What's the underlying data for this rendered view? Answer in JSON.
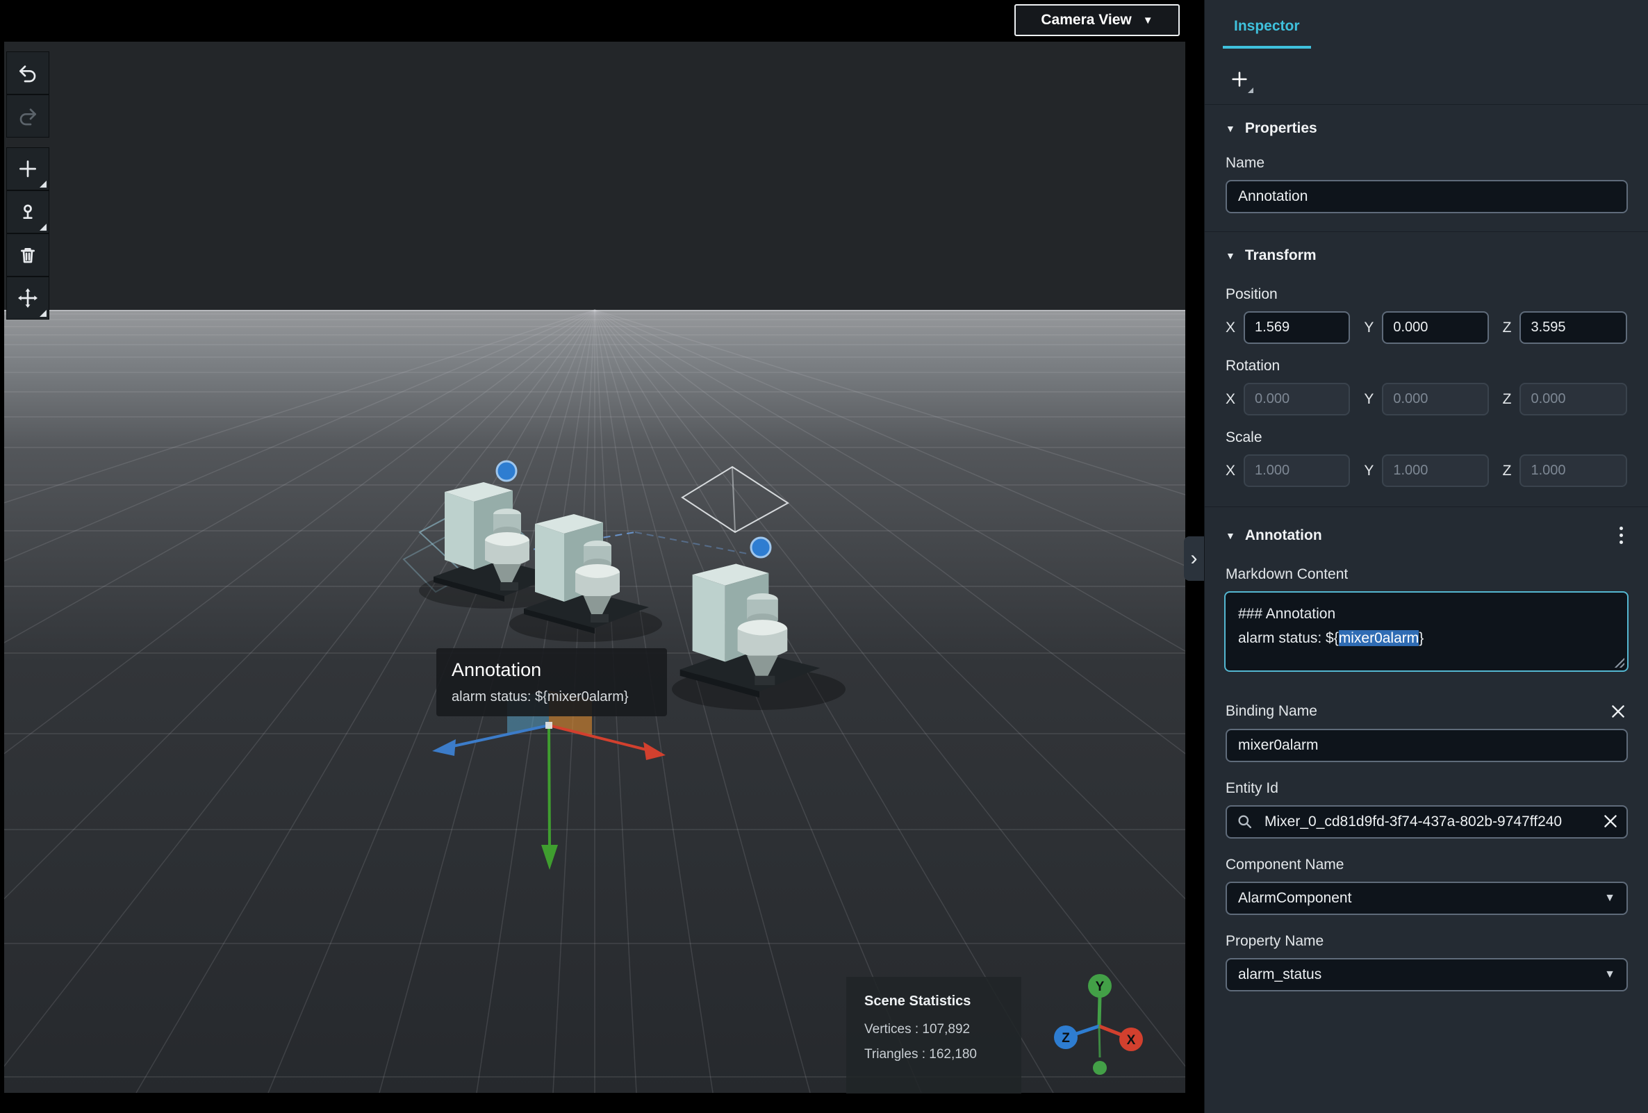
{
  "viewport": {
    "camera_view_button": "Camera View",
    "tooltip": {
      "title": "Annotation",
      "body": "alarm status: ${mixer0alarm}"
    },
    "scene_statistics": {
      "title": "Scene Statistics",
      "vertices": "Vertices : 107,892",
      "triangles": "Triangles : 162,180"
    },
    "axis_gizmo": {
      "x": "X",
      "y": "Y",
      "z": "Z"
    }
  },
  "toolbar": {
    "buttons": [
      "undo",
      "redo",
      "add-object",
      "add-anchor",
      "delete",
      "move"
    ]
  },
  "inspector": {
    "tab": "Inspector",
    "properties": {
      "title": "Properties",
      "name_label": "Name",
      "name_value": "Annotation"
    },
    "transform": {
      "title": "Transform",
      "x_label": "X",
      "y_label": "Y",
      "z_label": "Z",
      "position": {
        "label": "Position",
        "x": "1.569",
        "y": "0.000",
        "z": "3.595"
      },
      "rotation": {
        "label": "Rotation",
        "x": "0.000",
        "y": "0.000",
        "z": "0.000"
      },
      "scale": {
        "label": "Scale",
        "x": "1.000",
        "y": "1.000",
        "z": "1.000"
      }
    },
    "annotation": {
      "title": "Annotation",
      "markdown_label": "Markdown Content",
      "markdown_line1": "### Annotation",
      "markdown_prefix": "alarm status: ${",
      "markdown_selected": "mixer0alarm",
      "markdown_suffix": "}",
      "binding_name_label": "Binding Name",
      "binding_name_value": "mixer0alarm",
      "entity_id_label": "Entity Id",
      "entity_id_value": "Mixer_0_cd81d9fd-3f74-437a-802b-9747ff240",
      "component_name_label": "Component Name",
      "component_name_value": "AlarmComponent",
      "property_name_label": "Property Name",
      "property_name_value": "alarm_status"
    }
  },
  "colors": {
    "accent": "#3fc1dd",
    "text_selection": "#2f6cb4",
    "axis_x": "#d2402e",
    "axis_y": "#43a047",
    "axis_z": "#2e7dd1"
  }
}
